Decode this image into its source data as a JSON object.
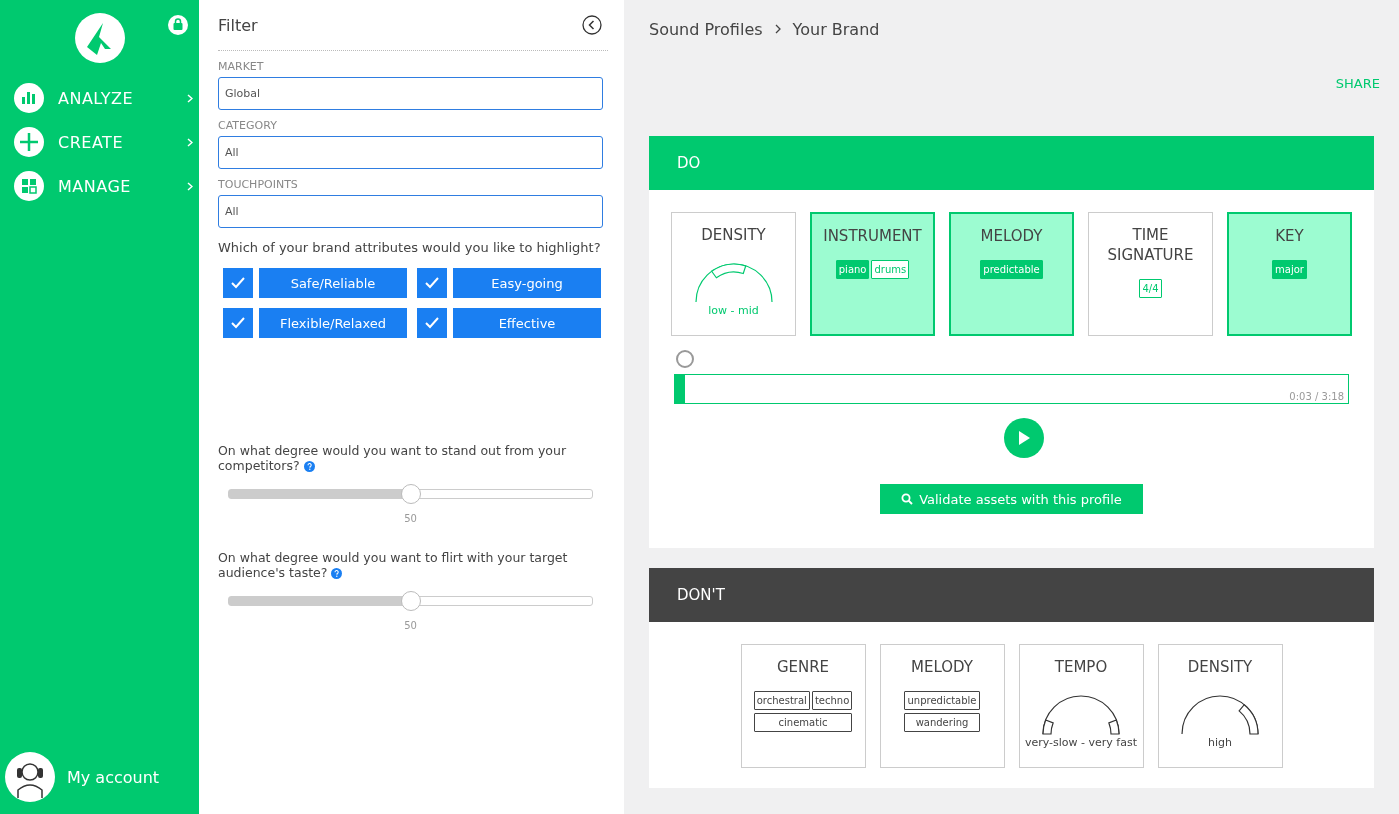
{
  "sidebar": {
    "nav": [
      {
        "label": "ANALYZE"
      },
      {
        "label": "CREATE"
      },
      {
        "label": "MANAGE"
      }
    ],
    "account": "My account"
  },
  "filter": {
    "title": "Filter",
    "fields": [
      {
        "label": "MARKET",
        "value": "Global"
      },
      {
        "label": "CATEGORY",
        "value": "All"
      },
      {
        "label": "TOUCHPOINTS",
        "value": "All"
      }
    ],
    "question": "Which of your brand attributes would you like to highlight?",
    "attributes": [
      {
        "label": "Safe/Reliable",
        "checked": true
      },
      {
        "label": "Easy-going",
        "checked": true
      },
      {
        "label": "Flexible/Relaxed",
        "checked": true
      },
      {
        "label": "Effective",
        "checked": true
      }
    ],
    "sliders": [
      {
        "question": "On what degree would you want to stand out from your competitors?",
        "level": 0.5,
        "value": "50"
      },
      {
        "question": "On what degree would you want to flirt with your target audience's taste?",
        "level": 0.5,
        "value": "50"
      }
    ]
  },
  "breadcrumb": [
    "Sound Profiles",
    "Your Brand"
  ],
  "share": "SHARE",
  "sections": [
    {
      "kind": "do",
      "title": "DO",
      "cards": [
        {
          "title": "DENSITY",
          "kind": "gauge",
          "highlighted": false,
          "caption": "low - mid"
        },
        {
          "title": "INSTRUMENT",
          "kind": "tags",
          "highlighted": true,
          "tag_rows": [
            [
              {
                "label": "piano",
                "selected": true
              },
              {
                "label": "drums",
                "selected": false
              }
            ]
          ]
        },
        {
          "title": "MELODY",
          "kind": "tags",
          "highlighted": true,
          "tag_rows": [
            [
              {
                "label": "predictable",
                "selected": true
              }
            ]
          ]
        },
        {
          "title": "TIME SIGNATURE",
          "kind": "tags",
          "highlighted": false,
          "tag_rows": [
            [
              {
                "label": "4/4",
                "selected": false
              }
            ]
          ]
        },
        {
          "title": "KEY",
          "kind": "tags",
          "highlighted": true,
          "tag_rows": [
            [
              {
                "label": "major",
                "selected": true
              }
            ]
          ]
        }
      ],
      "player": {
        "level": 0.015,
        "time": "0:03 / 3:18"
      },
      "action": "Validate assets with this profile"
    },
    {
      "kind": "dont",
      "title": "DON'T",
      "cards": [
        {
          "title": "GENRE",
          "kind": "tags",
          "highlighted": false,
          "tag_rows": [
            [
              {
                "label": "orchestral",
                "selected": false
              },
              {
                "label": "techno",
                "selected": false
              }
            ],
            [
              {
                "label": "cinematic",
                "selected": false
              }
            ]
          ]
        },
        {
          "title": "MELODY",
          "kind": "tags",
          "highlighted": false,
          "tag_rows": [
            [
              {
                "label": "unpredictable",
                "selected": false
              }
            ],
            [
              {
                "label": "wandering",
                "selected": false
              }
            ]
          ]
        },
        {
          "title": "TEMPO",
          "kind": "gauge",
          "highlighted": false,
          "caption": "very-slow - very fast"
        },
        {
          "title": "DENSITY",
          "kind": "gauge",
          "highlighted": false,
          "caption": "high"
        }
      ]
    }
  ]
}
